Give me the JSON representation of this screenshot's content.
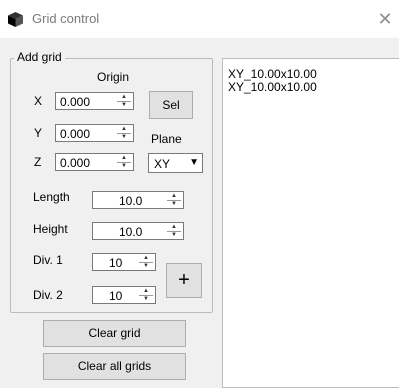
{
  "window": {
    "title": "Grid control",
    "icon": "box-icon",
    "close_symbol": "✕"
  },
  "add_grid": {
    "legend": "Add grid",
    "origin_label": "Origin",
    "x_label": "X",
    "x_value": "0.000",
    "y_label": "Y",
    "y_value": "0.000",
    "z_label": "Z",
    "z_value": "0.000",
    "sel_label": "Sel",
    "plane_label": "Plane",
    "plane_value": "XY",
    "length_label": "Length",
    "length_value": "10.0",
    "height_label": "Height",
    "height_value": "10.0",
    "div1_label": "Div. 1",
    "div1_value": "10",
    "div2_label": "Div. 2",
    "div2_value": "10",
    "add_label": "+"
  },
  "buttons": {
    "clear_grid": "Clear grid",
    "clear_all_grids": "Clear all grids"
  },
  "grid_list": [
    "XY_10.00x10.00",
    "XY_10.00x10.00"
  ]
}
